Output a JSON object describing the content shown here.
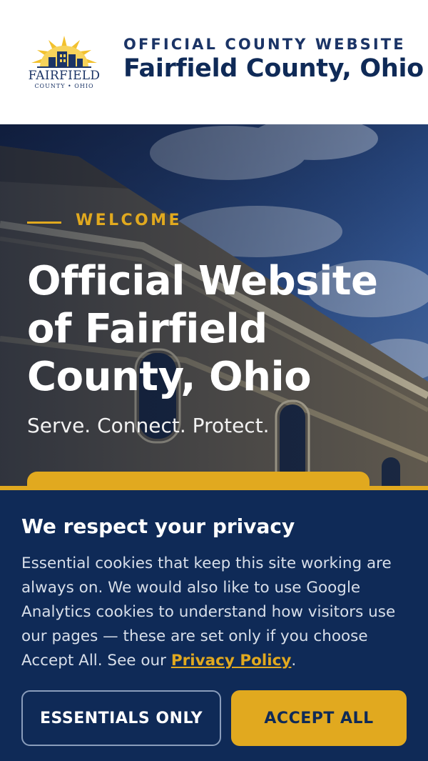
{
  "header": {
    "logo_name": "FAIRFIELD",
    "logo_sub": "COUNTY • OHIO",
    "eyebrow": "OFFICIAL COUNTY WEBSITE",
    "site_name": "Fairfield County, Ohio"
  },
  "hero": {
    "eyebrow": "WELCOME",
    "title_lines": [
      "Official Website",
      "of Fairfield",
      "County, Ohio"
    ],
    "tagline": "Serve. Connect. Protect."
  },
  "cookie": {
    "title": "We respect your privacy",
    "text": "Essential cookies that keep this site working are always on. We would also like to use Google Analytics cookies to understand how visitors use our pages — these are set only if you choose Accept All. See our",
    "policy_link": "Privacy Policy",
    "text_end": ".",
    "essentials_label": "ESSENTIALS ONLY",
    "accept_label": "ACCEPT ALL"
  },
  "colors": {
    "navy": "#0f2a57",
    "gold": "#e1a91f",
    "white": "#ffffff"
  }
}
